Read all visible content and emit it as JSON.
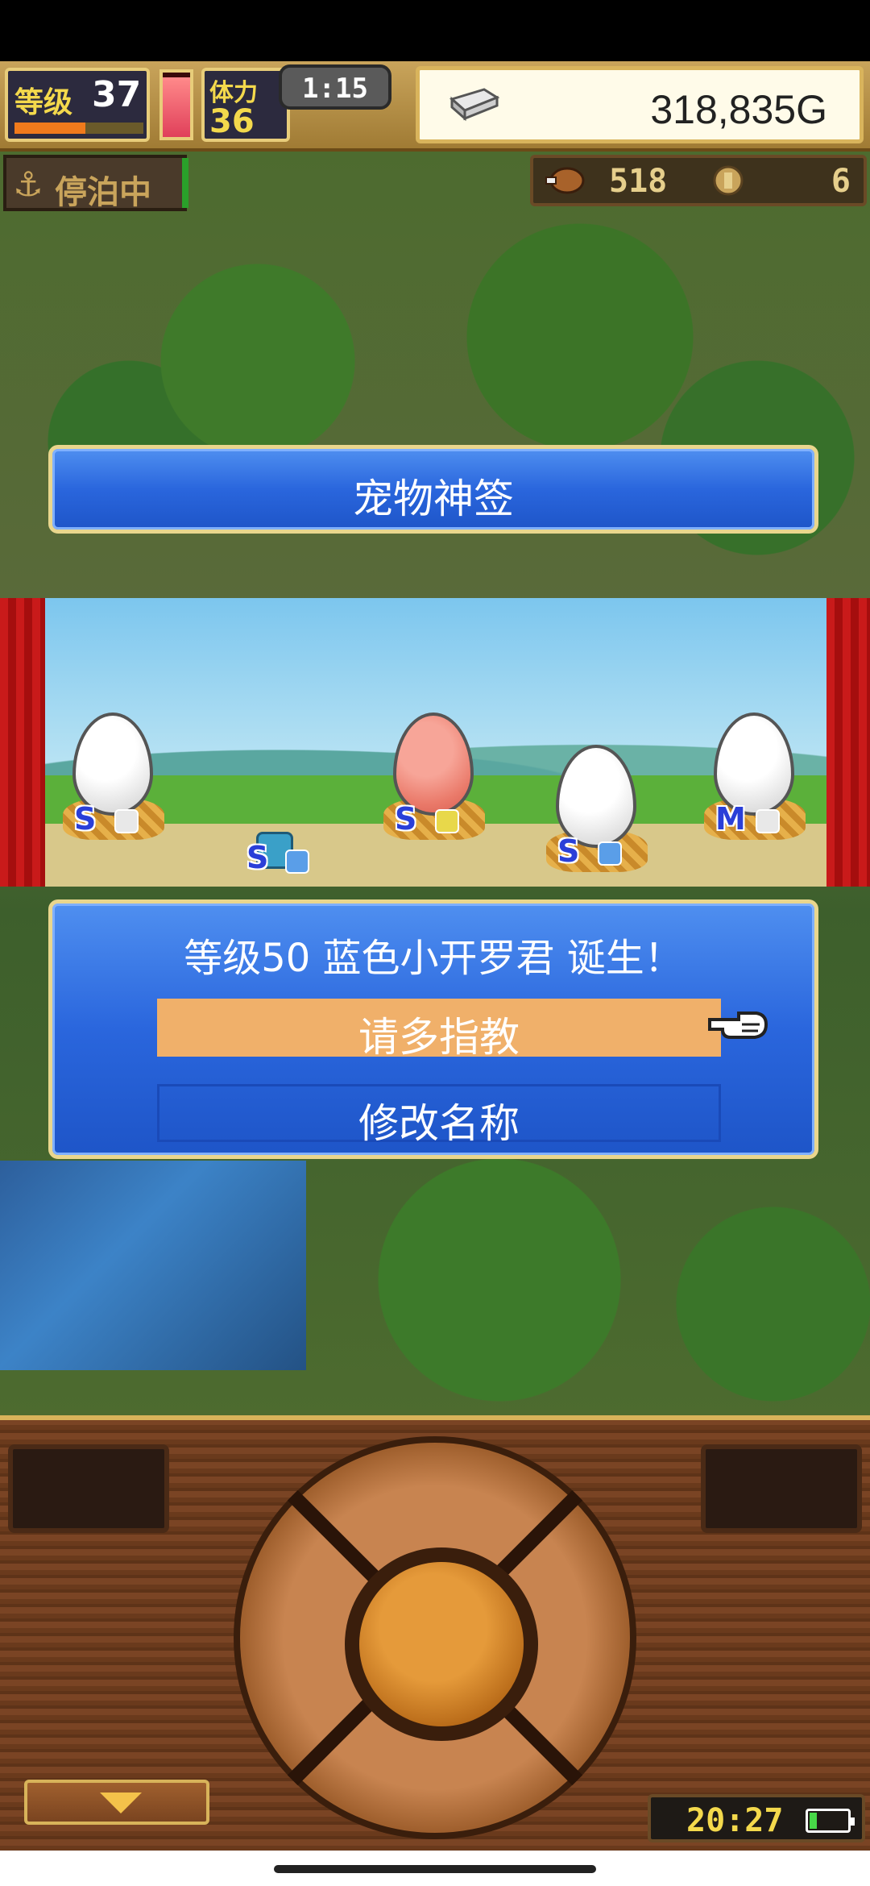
{
  "hud": {
    "level_label": "等级",
    "level": "37",
    "exp_fraction": 0.55,
    "hp_fraction": 0.92,
    "stamina_label": "体力",
    "stamina": "36",
    "time": "1:15",
    "money": "318,835G"
  },
  "status_row": {
    "anchor_label": "停泊中",
    "meat_count": "518",
    "coin_count": "6"
  },
  "title": "宠物神签",
  "eggs": [
    {
      "rank": "S",
      "color": "white",
      "element_color": "#e8e8e8"
    },
    {
      "rank": "S",
      "color": "pink",
      "element_color": "#e8d84a"
    },
    {
      "rank": "S",
      "color": "white",
      "element_color": "#5a9ee8"
    },
    {
      "rank": "M",
      "color": "white",
      "element_color": "#e8e8e8"
    }
  ],
  "pet": {
    "rank": "S"
  },
  "dialog": {
    "message": "等级50 蓝色小开罗君 诞生！",
    "confirm_label": "请多指教",
    "rename_label": "修改名称"
  },
  "clock": "20:27",
  "battery_fraction": 0.25,
  "colors": {
    "panel_blue": "#2a66dd",
    "selection_orange": "#f0b06a",
    "gold_border": "#e9d68d"
  }
}
